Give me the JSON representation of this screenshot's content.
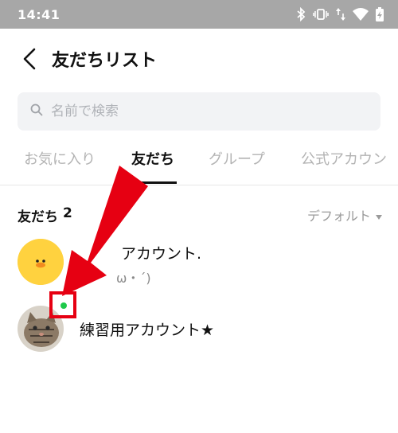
{
  "status_bar": {
    "time": "14:41",
    "icons": [
      "bluetooth-icon",
      "vibrate-icon",
      "data-arrows-icon",
      "wifi-icon",
      "battery-charging-icon"
    ]
  },
  "header": {
    "back_icon": "chevron-left-icon",
    "title": "友だちリスト"
  },
  "search": {
    "icon": "search-icon",
    "placeholder": "名前で検索"
  },
  "tabs": [
    {
      "label": "お気に入り",
      "active": false
    },
    {
      "label": "友だち",
      "active": true
    },
    {
      "label": "グループ",
      "active": false
    },
    {
      "label": "公式アカウン",
      "active": false
    }
  ],
  "friends": {
    "header_label": "友だち",
    "count": "2",
    "sort_label": "デフォルト",
    "sort_icon": "caret-down-icon",
    "items": [
      {
        "name_visible": "アカウント.",
        "status_visible": "ω・´)",
        "avatar": "duck-avatar"
      },
      {
        "name": "練習用アカウント★",
        "avatar": "cat-avatar",
        "online": true
      }
    ]
  },
  "colors": {
    "status_bar": "#a7a7a7",
    "search_bg": "#f2f3f5",
    "online_dot": "#1ec94a",
    "annotation_red": "#e60012",
    "duck_yellow": "#ffd23f"
  }
}
